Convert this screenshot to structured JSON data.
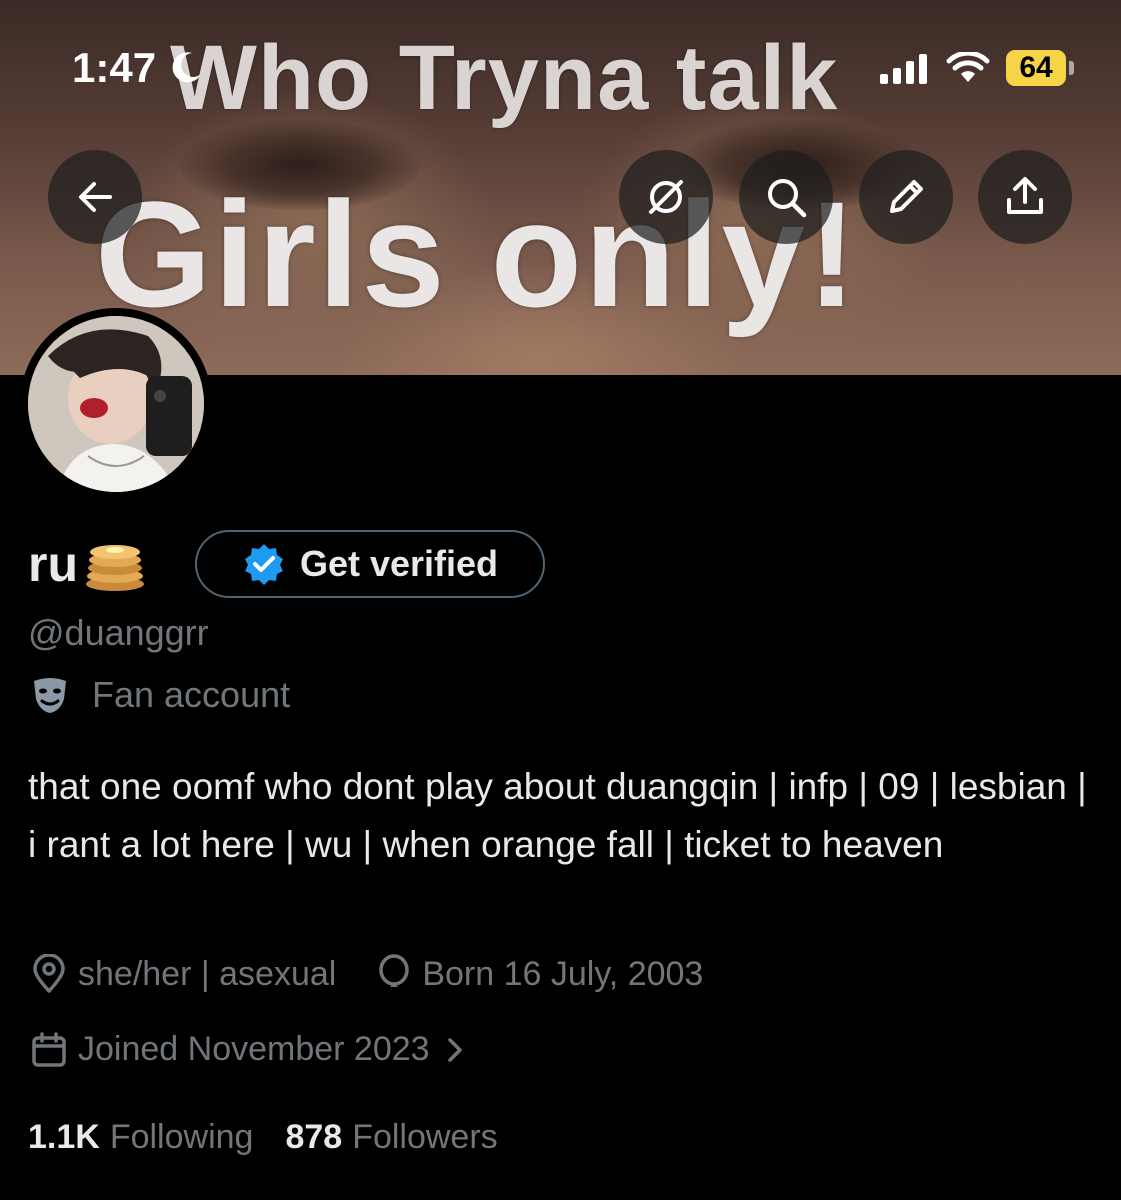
{
  "status_bar": {
    "time": "1:47",
    "battery": "64"
  },
  "banner": {
    "line1": "Who Tryna talk",
    "line2": "Girls only!"
  },
  "header_buttons": {
    "back_icon": "arrow-left-icon",
    "mute_icon": "eye-slash-icon",
    "search_icon": "search-icon",
    "edit_icon": "pencil-icon",
    "share_icon": "share-icon"
  },
  "profile": {
    "name": "ru",
    "name_emoji": "pancakes",
    "verify_button": "Get verified",
    "handle": "@duanggrr",
    "category": "Fan account",
    "bio": "that one oomf who dont play about duangqin | infp | 09 | lesbian | i rant a lot here | wu | when orange fall | ticket to heaven",
    "location": "she/her | asexual",
    "birthday": "Born 16 July, 2003",
    "joined": "Joined November 2023"
  },
  "stats": {
    "following_count": "1.1K",
    "following_label": "Following",
    "followers_count": "878",
    "followers_label": "Followers"
  },
  "colors": {
    "background": "#000000",
    "text_primary": "#e7e9ea",
    "text_secondary": "#71767b",
    "verified_blue": "#1d9bf0",
    "battery_yellow": "#f5d547"
  }
}
